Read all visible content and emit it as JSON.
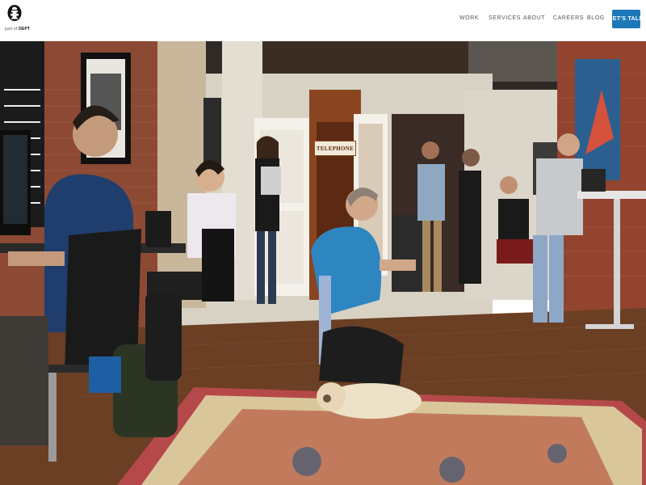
{
  "brand": {
    "logo_icon": "fire-hydrant-icon",
    "prefix": "part of",
    "name": "DEPT"
  },
  "nav": {
    "items": [
      {
        "label": "WORK"
      },
      {
        "label": "SERVICES"
      },
      {
        "label": "ABOUT"
      },
      {
        "label": "CAREERS"
      },
      {
        "label": "BLOG"
      }
    ],
    "cta_label": "LET'S TALK",
    "cta_color": "#1d78b8"
  },
  "hero": {
    "sign_text": "TELEPHONE"
  }
}
